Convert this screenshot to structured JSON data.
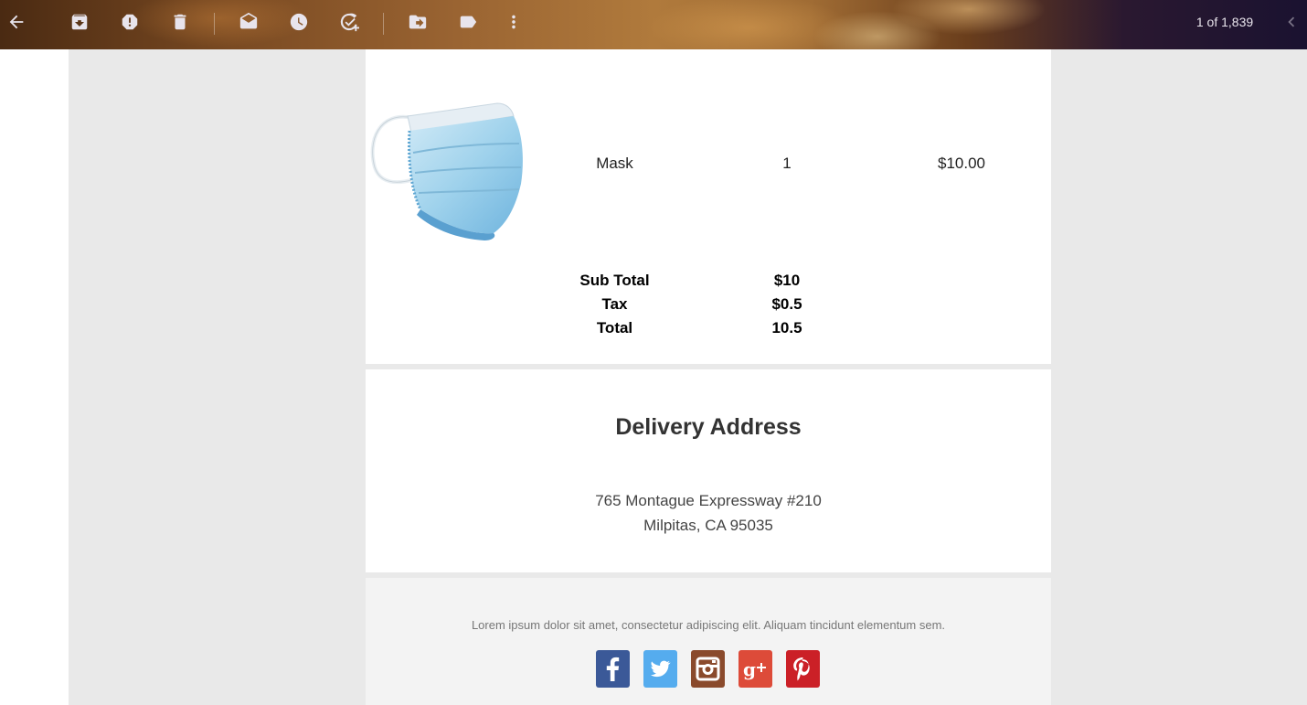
{
  "toolbar": {
    "icons": [
      "back-arrow-icon",
      "archive-icon",
      "report-spam-icon",
      "delete-icon",
      "mark-unread-icon",
      "snooze-icon",
      "add-task-icon",
      "move-to-icon",
      "label-icon",
      "more-vert-icon"
    ],
    "page_counter": "1 of 1,839",
    "nav_prev_icon": "chevron-left-icon"
  },
  "order": {
    "items": [
      {
        "name": "Mask",
        "quantity": "1",
        "price": "$10.00"
      }
    ],
    "summary": [
      {
        "label": "Sub Total",
        "value": "$10"
      },
      {
        "label": "Tax",
        "value": "$0.5"
      },
      {
        "label": "Total",
        "value": "10.5"
      }
    ]
  },
  "delivery": {
    "title": "Delivery Address",
    "line1": "765 Montague Expressway #210",
    "line2": "Milpitas, CA 95035"
  },
  "footer": {
    "text": "Lorem ipsum dolor sit amet, consectetur adipiscing elit. Aliquam tincidunt elementum sem.",
    "social": [
      {
        "name": "facebook",
        "color": "#3b5998"
      },
      {
        "name": "twitter",
        "color": "#55acee"
      },
      {
        "name": "instagram",
        "color": "#8a4a2c"
      },
      {
        "name": "google-plus",
        "color": "#dd4b39"
      },
      {
        "name": "pinterest",
        "color": "#cb2027"
      }
    ]
  },
  "colors": {
    "toolbar_icon": "#e8e4ec",
    "page_background": "#e9e9e9",
    "footer_background": "#f3f3f3"
  }
}
